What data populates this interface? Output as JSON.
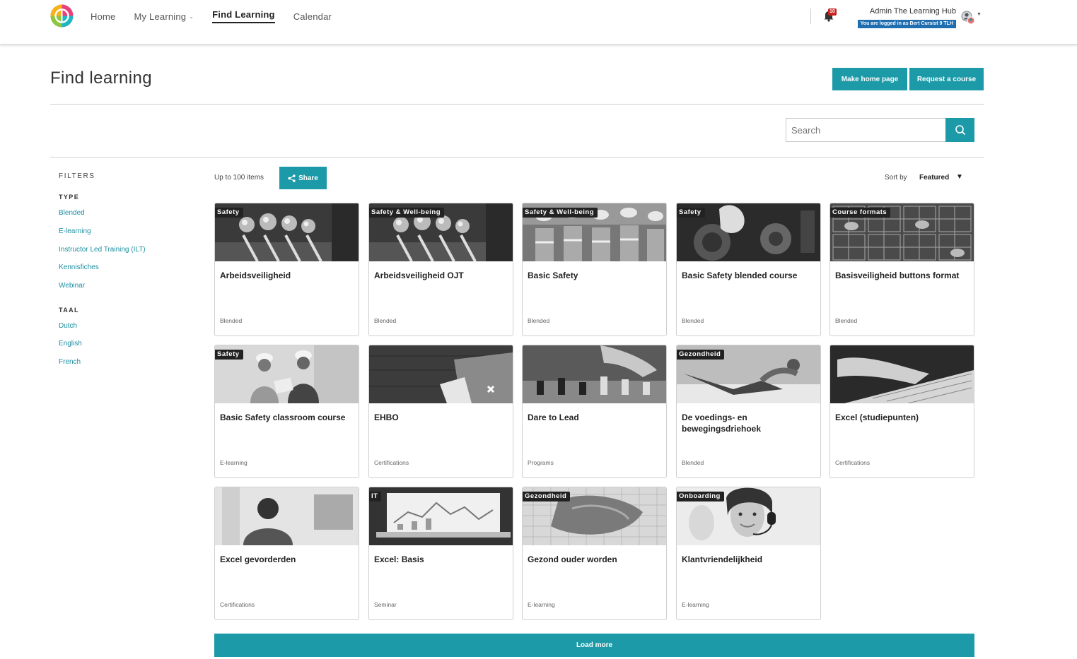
{
  "nav": {
    "items": [
      {
        "label": "Home",
        "active": false,
        "caret": false
      },
      {
        "label": "My Learning",
        "active": false,
        "caret": true
      },
      {
        "label": "Find Learning",
        "active": true,
        "caret": false
      },
      {
        "label": "Calendar",
        "active": false,
        "caret": false
      }
    ],
    "notification_count": "10",
    "user_name": "Admin The Learning Hub",
    "logged_in_as": "You are logged in as Bert Cursist 9 TLH"
  },
  "header": {
    "title": "Find learning",
    "make_home_label": "Make home page",
    "request_course_label": "Request a course"
  },
  "search": {
    "placeholder": "Search"
  },
  "filters": {
    "title": "FILTERS",
    "groups": [
      {
        "title": "TYPE",
        "options": [
          "Blended",
          "E-learning",
          "Instructor Led Training (ILT)",
          "Kennisfiches",
          "Webinar"
        ]
      },
      {
        "title": "TAAL",
        "options": [
          "Dutch",
          "English",
          "French"
        ]
      }
    ]
  },
  "toolbar": {
    "count_text": "Up to 100 items",
    "share_label": "Share",
    "sort_label": "Sort by",
    "sort_value": "Featured"
  },
  "cards": [
    {
      "tag": "Safety",
      "title": "Arbeidsveiligheid",
      "type": "Blended",
      "image": "helmets"
    },
    {
      "tag": "Safety & Well-being",
      "title": "Arbeidsveiligheid OJT",
      "type": "Blended",
      "image": "helmets"
    },
    {
      "tag": "Safety & Well-being",
      "title": "Basic Safety",
      "type": "Blended",
      "image": "workers"
    },
    {
      "tag": "Safety",
      "title": "Basic Safety blended course",
      "type": "Blended",
      "image": "machine"
    },
    {
      "tag": "Course formats",
      "title": "Basisveiligheid buttons format",
      "type": "Blended",
      "image": "lockers"
    },
    {
      "tag": "Safety",
      "title": "Basic Safety classroom course",
      "type": "E-learning",
      "image": "people"
    },
    {
      "tag": "",
      "title": "EHBO",
      "type": "Certifications",
      "image": "firstaid"
    },
    {
      "tag": "",
      "title": "Dare to Lead",
      "type": "Programs",
      "image": "chess"
    },
    {
      "tag": "Gezondheid",
      "title": "De voedings- en bewegingsdriehoek",
      "type": "Blended",
      "image": "fitness"
    },
    {
      "tag": "",
      "title": "Excel (studiepunten)",
      "type": "Certifications",
      "image": "keyboard"
    },
    {
      "tag": "",
      "title": "Excel gevorderden",
      "type": "Certifications",
      "image": "office"
    },
    {
      "tag": "IT",
      "title": "Excel: Basis",
      "type": "Seminar",
      "image": "laptop"
    },
    {
      "tag": "Gezondheid",
      "title": "Gezond ouder worden",
      "type": "E-learning",
      "image": "hands"
    },
    {
      "tag": "Onboarding",
      "title": "Klantvriendelijkheid",
      "type": "E-learning",
      "image": "headset"
    }
  ],
  "load_more_label": "Load more",
  "colors": {
    "accent": "#1d9aa7",
    "badge": "#c9211e",
    "tag_bg": "#222222"
  }
}
